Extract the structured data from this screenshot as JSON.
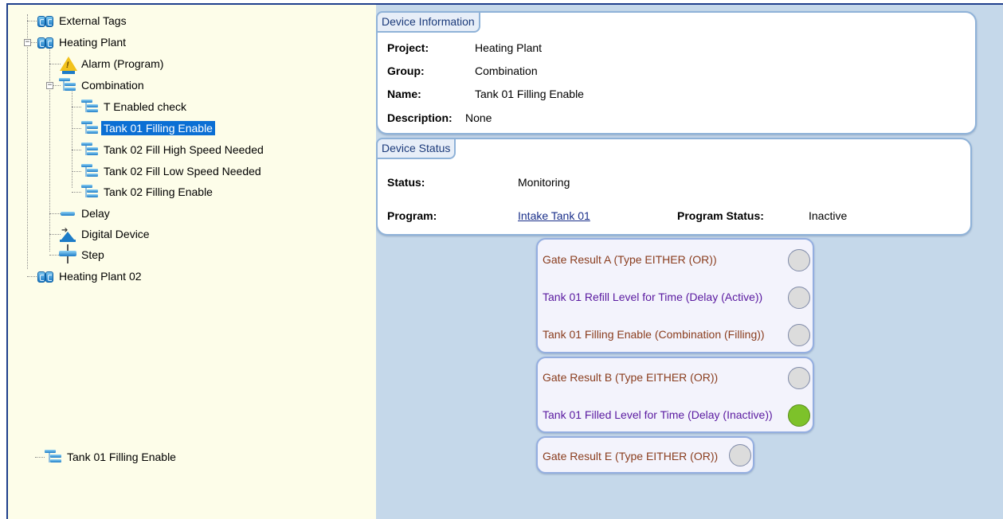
{
  "tree": {
    "nodes": [
      {
        "label": "External Tags",
        "icon": "folder-icon"
      },
      {
        "label": "Heating Plant",
        "icon": "folder-icon",
        "expander": "⊟"
      },
      {
        "label": "Alarm (Program)",
        "icon": "alarm-icon"
      },
      {
        "label": "Combination",
        "icon": "combination-icon",
        "expander": "⊟"
      },
      {
        "label": "T Enabled check",
        "icon": "combination-icon"
      },
      {
        "label": "Tank 01 Filling Enable",
        "icon": "combination-icon",
        "selected": true
      },
      {
        "label": "Tank 02 Fill High Speed Needed",
        "icon": "combination-icon"
      },
      {
        "label": "Tank 02 Fill Low Speed Needed",
        "icon": "combination-icon"
      },
      {
        "label": "Tank 02 Filling Enable",
        "icon": "combination-icon"
      },
      {
        "label": "Delay",
        "icon": "delay-icon"
      },
      {
        "label": "Digital Device",
        "icon": "digital-device-icon"
      },
      {
        "label": "Step",
        "icon": "step-icon"
      },
      {
        "label": "Heating Plant 02",
        "icon": "folder-icon"
      }
    ],
    "detached_node": {
      "label": "Tank 01 Filling Enable",
      "icon": "combination-icon"
    }
  },
  "device_information": {
    "tab": "Device Information",
    "project_key": "Project:",
    "project_value": "Heating Plant",
    "group_key": "Group:",
    "group_value": "Combination",
    "name_key": "Name:",
    "name_value": "Tank 01 Filling Enable",
    "description_key": "Description:",
    "description_value": "None"
  },
  "device_status": {
    "tab": "Device Status",
    "status_key": "Status:",
    "status_value": "Monitoring",
    "program_key": "Program:",
    "program_value": "Intake Tank 01",
    "program_status_key": "Program Status:",
    "program_status_value": "Inactive"
  },
  "gates": [
    {
      "rows": [
        {
          "text": "Gate Result A (Type EITHER (OR))",
          "color": "brown",
          "lamp": "#dcdcdc"
        },
        {
          "text": "Tank 01 Refill Level for Time  (Delay (Active))",
          "color": "purple",
          "lamp": "#dcdcdc"
        },
        {
          "text": "Tank 01 Filling Enable  (Combination (Filling))",
          "color": "brown",
          "lamp": "#dcdcdc"
        }
      ]
    },
    {
      "rows": [
        {
          "text": "Gate Result B (Type EITHER (OR))",
          "color": "brown",
          "lamp": "#dcdcdc"
        },
        {
          "text": "Tank 01 Filled Level for Time (Delay (Inactive))",
          "color": "purple",
          "lamp": "#7dc22a"
        }
      ]
    },
    {
      "rows": [
        {
          "text": "Gate Result E (Type EITHER (OR))",
          "color": "brown",
          "lamp": "#dcdcdc"
        }
      ]
    }
  ],
  "colors": {
    "tree_background": "#fdfde9",
    "right_background": "#c5d8ea",
    "selection": "#0b6fd4",
    "lamp_off": "#dcdcdc",
    "lamp_on": "#7dc22a"
  }
}
